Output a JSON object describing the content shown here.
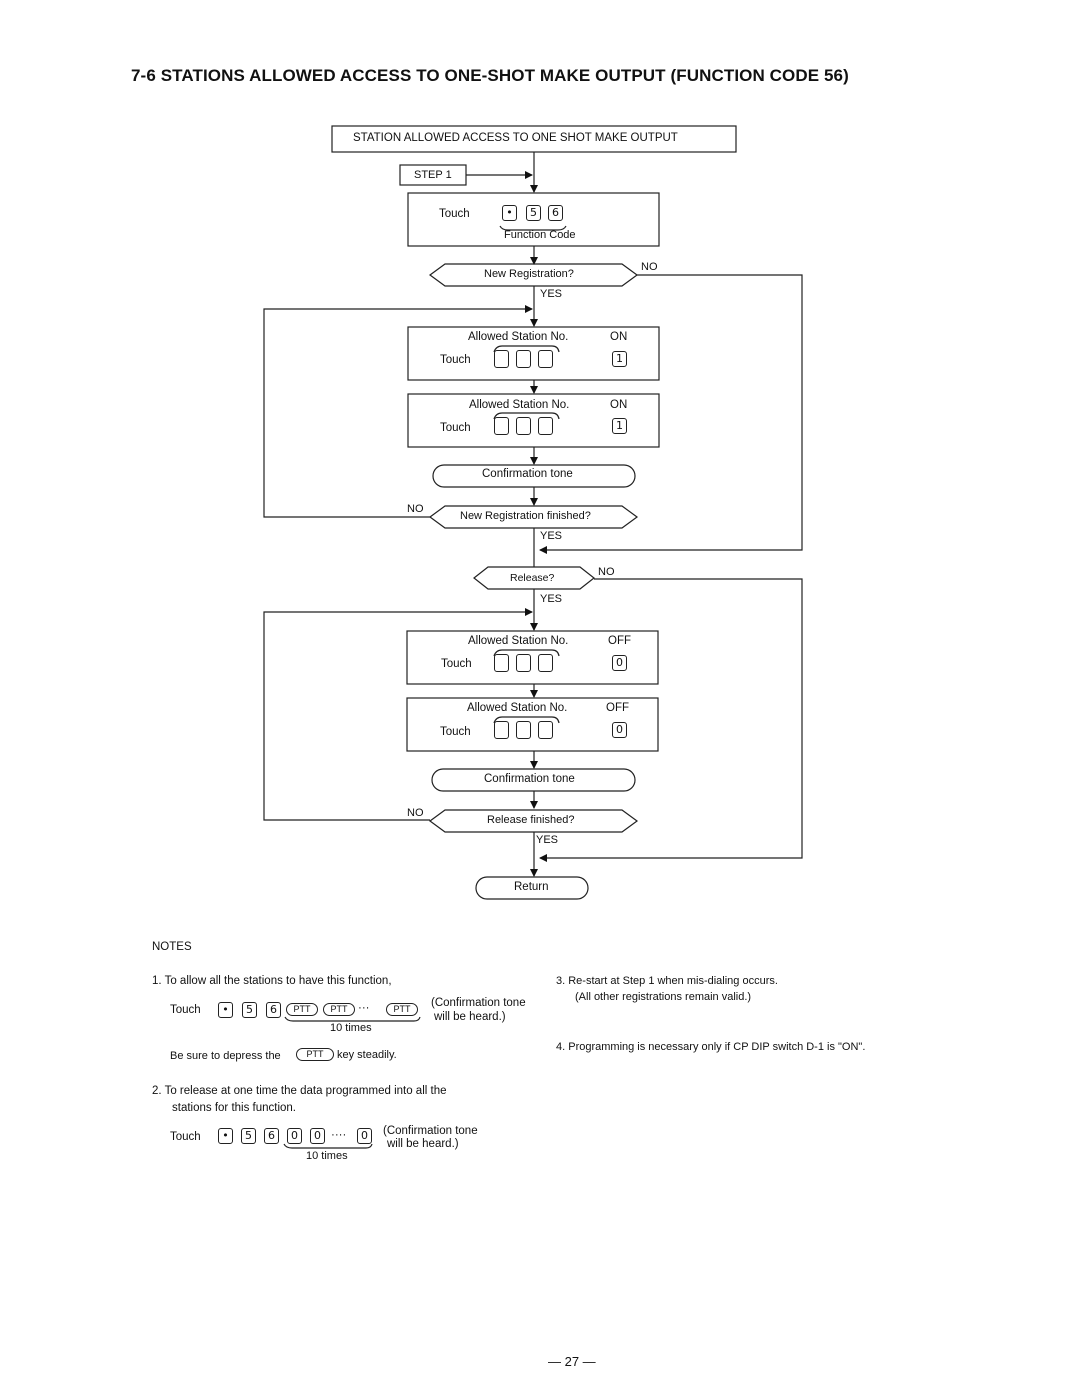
{
  "page": {
    "title": "7-6 STATIONS ALLOWED ACCESS TO ONE-SHOT MAKE OUTPUT (FUNCTION CODE 56)",
    "page_number": "— 27 —"
  },
  "flowchart": {
    "header_box": "STATION ALLOWED ACCESS TO ONE SHOT MAKE OUTPUT",
    "step_label": "STEP 1",
    "step1": {
      "touch": "Touch",
      "keys": [
        "•",
        "5",
        "6"
      ],
      "caption": "Function Code"
    },
    "decision_new_registration": "New Registration?",
    "decision_new_registration_finished": "New Registration finished?",
    "decision_release": "Release?",
    "decision_release_finished": "Release finished?",
    "yes": "YES",
    "no": "NO",
    "register_boxes": [
      {
        "label": "Allowed Station No.",
        "touch": "Touch",
        "state": "ON",
        "state_key": "1"
      },
      {
        "label": "Allowed Station No.",
        "touch": "Touch",
        "state": "ON",
        "state_key": "1"
      }
    ],
    "release_boxes": [
      {
        "label": "Allowed Station No.",
        "touch": "Touch",
        "state": "OFF",
        "state_key": "0"
      },
      {
        "label": "Allowed Station No.",
        "touch": "Touch",
        "state": "OFF",
        "state_key": "0"
      }
    ],
    "confirmation_tone": "Confirmation tone",
    "return": "Return"
  },
  "notes": {
    "heading": "NOTES",
    "note1": {
      "text": "1.  To allow all the stations to have this function,",
      "touch": "Touch",
      "keys": [
        "•",
        "5",
        "6"
      ],
      "ptt": "PTT",
      "ellipsis": "···",
      "times": "10 times",
      "result_line1": "(Confirmation tone",
      "result_line2": "will be heard.)",
      "caution_before": "Be sure to depress the",
      "caution_after": "key steadily."
    },
    "note2": {
      "line1": "2.  To release at one time the data programmed into all the",
      "line2": "stations for this function.",
      "touch": "Touch",
      "keys": [
        "•",
        "5",
        "6",
        "0",
        "0"
      ],
      "last_key": "0",
      "ellipsis": "····",
      "times": "10 times",
      "result_line1": "(Confirmation tone",
      "result_line2": "will be heard.)"
    },
    "note3": {
      "line1": "3.  Re-start at Step 1  when mis-dialing occurs.",
      "line2": "(All other registrations remain valid.)"
    },
    "note4": "4.  Programming is necessary only if CP DIP switch D-1 is \"ON\"."
  }
}
